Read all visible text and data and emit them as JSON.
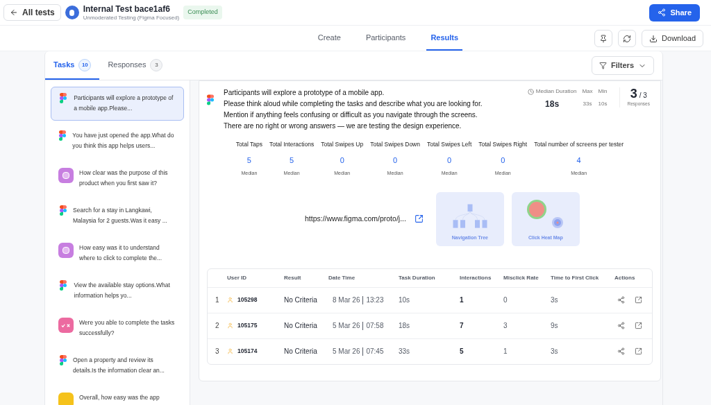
{
  "header": {
    "back_label": "All tests",
    "title": "Internal Test bace1af6",
    "subtitle": "Unmoderated Testing (Figma Focused)",
    "status": "Completed",
    "share_label": "Share"
  },
  "nav_tabs": [
    {
      "label": "Create",
      "selected": false
    },
    {
      "label": "Participants",
      "selected": false
    },
    {
      "label": "Results",
      "selected": true
    }
  ],
  "download_label": "Download",
  "panel_tabs": [
    {
      "label": "Tasks",
      "count": "10",
      "selected": true
    },
    {
      "label": "Responses",
      "count": "3",
      "selected": false
    }
  ],
  "filters_label": "Filters",
  "tasks": [
    {
      "kind": "figma",
      "text": "Participants will explore a prototype of a mobile app.Please...",
      "selected": true
    },
    {
      "kind": "figma",
      "text": "You have just opened the app.What do you think this app helps users...",
      "selected": false
    },
    {
      "kind": "survey",
      "text": "How clear was the purpose of this product when you first saw it?",
      "selected": false
    },
    {
      "kind": "figma",
      "text": "Search for a stay in Langkawi, Malaysia for 2 guests.Was it easy ...",
      "selected": false
    },
    {
      "kind": "survey",
      "text": "How easy was it to understand where to click to complete the...",
      "selected": false
    },
    {
      "kind": "figma",
      "text": "View the available stay options.What information helps yo...",
      "selected": false
    },
    {
      "kind": "yes_no",
      "text": "Were you able to complete the tasks successfully?",
      "selected": false
    },
    {
      "kind": "figma",
      "text": "Open a property and review its details.Is the information clear an...",
      "selected": false
    },
    {
      "kind": "rating",
      "text": "Overall, how easy was the app",
      "selected": false
    }
  ],
  "task_detail": {
    "lines": [
      "Participants will explore a prototype of a mobile app.",
      "Please think aloud while completing the tasks and describe what you are looking for.",
      "Mention if anything feels confusing or difficult as you navigate through the screens.",
      "There are no right or wrong answers — we are testing the design experience."
    ],
    "median_label": "Median Duration",
    "median_value": "18s",
    "max_label": "Max",
    "max_value": "33s",
    "min_label": "Min",
    "min_value": "10s",
    "responses_count": "3",
    "responses_total": "/ 3",
    "responses_label": "Responses"
  },
  "metrics": [
    {
      "label": "Total Taps",
      "value": "5",
      "sub": "Median"
    },
    {
      "label": "Total Interactions",
      "value": "5",
      "sub": "Median"
    },
    {
      "label": "Total Swipes Up",
      "value": "0",
      "sub": "Median"
    },
    {
      "label": "Total Swipes Down",
      "value": "0",
      "sub": "Median"
    },
    {
      "label": "Total Swipes Left",
      "value": "0",
      "sub": "Median"
    },
    {
      "label": "Total Swipes Right",
      "value": "0",
      "sub": "Median"
    },
    {
      "label": "Total number of screens per tester",
      "value": "4",
      "sub": "Median"
    }
  ],
  "prototype_url": "https://www.figma.com/proto/j...",
  "visual_cards": [
    {
      "kind": "tree",
      "label": "Navigation Tree"
    },
    {
      "kind": "heatmap",
      "label": "Click Heat Map"
    }
  ],
  "table": {
    "columns": [
      "User ID",
      "Result",
      "Date Time",
      "Task Duration",
      "Interactions",
      "Misclick Rate",
      "Time to First Click",
      "Actions"
    ],
    "rows": [
      {
        "index": "1",
        "user_id": "105298",
        "result": "No Criteria",
        "date": "8 Mar 26",
        "time": "13:23",
        "duration": "10s",
        "interactions": "1",
        "misclick": "0",
        "first_click": "3s"
      },
      {
        "index": "2",
        "user_id": "105175",
        "result": "No Criteria",
        "date": "5 Mar 26",
        "time": "07:58",
        "duration": "18s",
        "interactions": "7",
        "misclick": "3",
        "first_click": "9s"
      },
      {
        "index": "3",
        "user_id": "105174",
        "result": "No Criteria",
        "date": "5 Mar 26",
        "time": "07:45",
        "duration": "33s",
        "interactions": "5",
        "misclick": "1",
        "first_click": "3s"
      }
    ]
  }
}
